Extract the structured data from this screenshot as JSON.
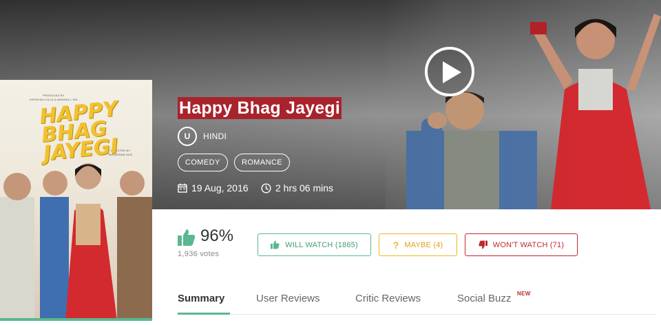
{
  "hero": {
    "title": "Happy Bhag Jayegi",
    "certificate": "U",
    "language": "HINDI",
    "genres": [
      "COMEDY",
      "ROMANCE"
    ],
    "release_date": "19 Aug, 2016",
    "duration": "2 hrs 06 mins",
    "icons": {
      "play": "play-icon",
      "calendar": "calendar-icon",
      "clock": "clock-icon"
    }
  },
  "poster": {
    "title_lines": [
      "HAPPY",
      "BHAG",
      "JAYEGI"
    ],
    "credit_produced": "PRODUCED BY",
    "credit_producers": "KRISHIKA LULLA & AANAND L RAI",
    "credit_directed": "DIRECTED BY",
    "credit_director": "MUDASSAR AZIZ"
  },
  "rating": {
    "percent": "96%",
    "votes": "1,936 votes"
  },
  "actions": {
    "will_watch": "WILL WATCH (1865)",
    "maybe": "MAYBE (4)",
    "wont_watch": "WON'T WATCH (71)"
  },
  "tabs": {
    "items": [
      "Summary",
      "User Reviews",
      "Critic Reviews",
      "Social Buzz"
    ],
    "active": "Summary",
    "new_badge": "NEW"
  },
  "colors": {
    "title_bg": "#a9232d",
    "green": "#5ab88e",
    "amber": "#f0b429",
    "red": "#c0282f"
  }
}
